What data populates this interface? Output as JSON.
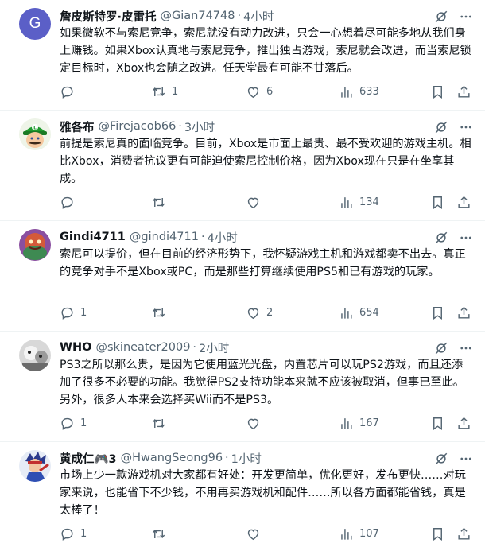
{
  "tweets": [
    {
      "name": "詹皮斯特罗·皮雷托",
      "handle": "@Gian74748",
      "time": "4小时",
      "avatar_letter": "G",
      "avatar_color": "#5b5fc7",
      "text": "如果微软不与索尼竞争，索尼就没有动力改进，只会一心想着尽可能多地从我们身上赚钱。如果Xbox认真地与索尼竞争，推出独占游戏，索尼就会改进，而当索尼锁定目标时，Xbox也会随之改进。任天堂最有可能不甘落后。",
      "retweets": "1",
      "likes": "6",
      "views": "633"
    },
    {
      "name": "雅各布",
      "handle": "@Firejacob66",
      "time": "3小时",
      "avatar_icon": "luigi-avatar-icon",
      "text": "前提是索尼真的面临竞争。目前，Xbox是市面上最贵、最不受欢迎的游戏主机。相比Xbox，消费者抗议更有可能迫使索尼控制价格，因为Xbox现在只是在坐享其成。",
      "retweets": "",
      "likes": "",
      "views": "134"
    },
    {
      "name": "Gindi4711",
      "handle": "@gindi4711",
      "time": "4小时",
      "avatar_icon": "character-avatar-icon",
      "text": "索尼可以提价，但在目前的经济形势下，我怀疑游戏主机和游戏都卖不出去。真正的竞争对手不是Xbox或PC，而是那些打算继续使用PS5和已有游戏的玩家。",
      "replies": "1",
      "retweets": "",
      "likes": "2",
      "views": "654"
    },
    {
      "name": "WHO",
      "handle": "@skineater2009",
      "time": "2小时",
      "avatar_icon": "grayscale-avatar-icon",
      "text": "PS3之所以那么贵，是因为它使用蓝光光盘，内置芯片可以玩PS2游戏，而且还添加了很多不必要的功能。我觉得PS2支持功能本来就不应该被取消，但事已至此。另外，很多人本来会选择买Wii而不是PS3。",
      "replies": "1",
      "retweets": "",
      "likes": "",
      "views": "167"
    },
    {
      "name": "黄成仁🎮3",
      "handle": "@HwangSeong96",
      "time": "1小时",
      "avatar_icon": "anime-avatar-icon",
      "text": "市场上少一款游戏机对大家都有好处：开发更简单，优化更好，发布更快……对玩家来说，也能省下不少钱，不用再买游戏机和配件……所以各方面都能省钱，真是太棒了！",
      "replies": "1",
      "retweets": "",
      "likes": "",
      "views": "107"
    }
  ],
  "colors": {
    "text": "#0f1419",
    "secondary": "#536471",
    "divider": "#eff3f4"
  }
}
